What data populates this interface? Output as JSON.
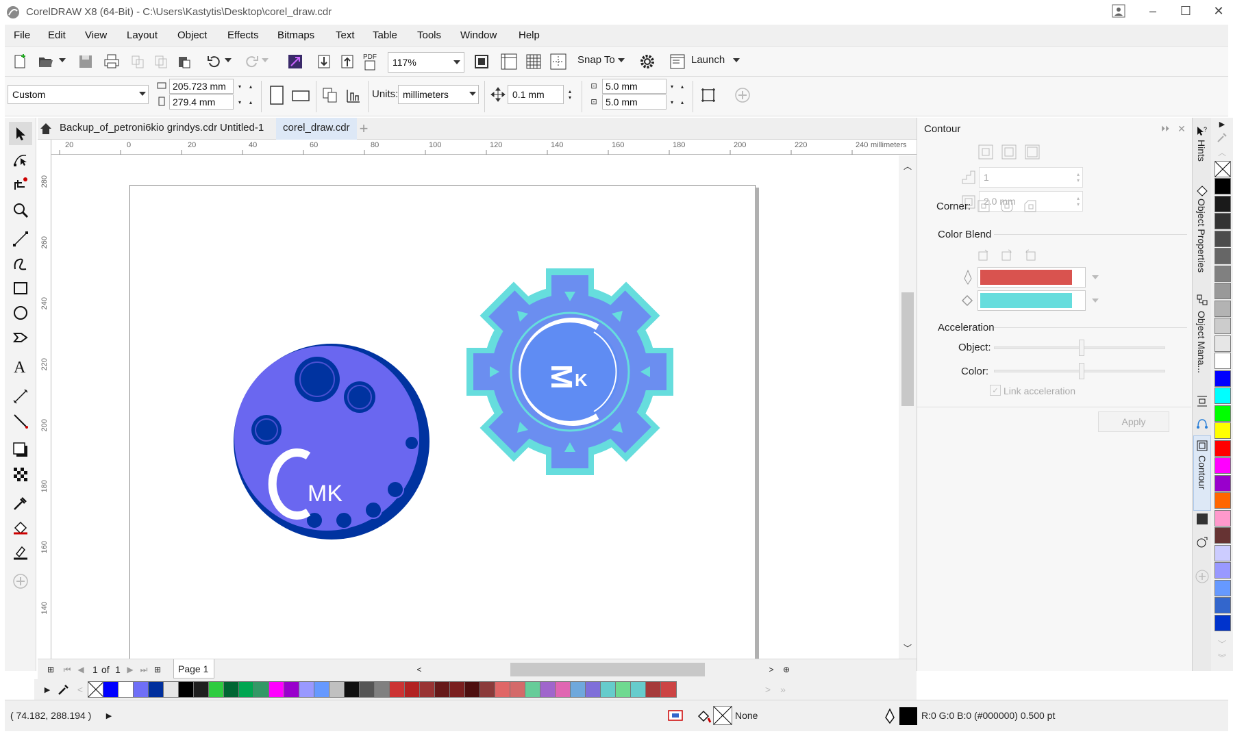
{
  "window": {
    "title": "CorelDRAW X8 (64-Bit) - C:\\Users\\Kastytis\\Desktop\\corel_draw.cdr"
  },
  "menu": [
    "File",
    "Edit",
    "View",
    "Layout",
    "Object",
    "Effects",
    "Bitmaps",
    "Text",
    "Table",
    "Tools",
    "Window",
    "Help"
  ],
  "toolbar1": {
    "zoom": "117%",
    "snap_to": "Snap To",
    "launch": "Launch"
  },
  "toolbar2": {
    "page_size": "Custom",
    "width": "205.723 mm",
    "height": "279.4 mm",
    "units_label": "Units:",
    "units": "millimeters",
    "nudge": "0.1 mm",
    "dup_x": "5.0 mm",
    "dup_y": "5.0 mm"
  },
  "tabs": [
    "Backup_of_petroni6kio grindys.cdr",
    "Untitled-1",
    "corel_draw.cdr"
  ],
  "ruler": {
    "h_ticks": [
      "20",
      "0",
      "20",
      "40",
      "60",
      "80",
      "100",
      "120",
      "140",
      "160",
      "180",
      "200",
      "220",
      "240"
    ],
    "h_unit": "millimeters",
    "v_ticks": [
      "280",
      "260",
      "240",
      "220",
      "200",
      "180",
      "160",
      "140"
    ]
  },
  "artwork": {
    "logo1_text": "MK",
    "logo2_text_big": "M",
    "logo2_text_small": "K"
  },
  "pagebar": {
    "counter": "1",
    "of": "of",
    "total": "1",
    "page_tab": "Page 1"
  },
  "palette": [
    "#0000ff",
    "#ffffff",
    "#6f6ff7",
    "#002f9d",
    "#e6e6e6",
    "#000000",
    "#1f1f1f",
    "#2ecc40",
    "#006633",
    "#00a651",
    "#339966",
    "#ff00ff",
    "#9900cc",
    "#9999ff",
    "#6699ff",
    "#c0c0c0",
    "#111111",
    "#555555",
    "#808080",
    "#cc3333",
    "#b22222",
    "#993333",
    "#661919",
    "#7a1f1f",
    "#4d0f0f",
    "#8b3a3a",
    "#e06666",
    "#d46a6a",
    "#66cc99",
    "#a066cc",
    "#e066b2",
    "#6fa8dc",
    "#7f6fd9",
    "#66cccc",
    "#6fd990",
    "#66cccc",
    "#a63a3a",
    "#cc4444"
  ],
  "status": {
    "coords": "( 74.182, 288.194 )",
    "fill": "None",
    "outline": "R:0 G:0 B:0 (#000000)  0.500 pt"
  },
  "docker": {
    "title": "Contour",
    "steps": "1",
    "offset": "2.0 mm",
    "corner_label": "Corner:",
    "color_blend_label": "Color Blend",
    "outline_color": "#d9534f",
    "fill_color": "#66dddd",
    "acceleration_label": "Acceleration",
    "object_label": "Object:",
    "color_label": "Color:",
    "link_label": "Link acceleration",
    "apply": "Apply"
  },
  "vtabs": {
    "hints": "Hints",
    "object_properties": "Object Properties",
    "object_manager": "Object Mana...",
    "contour": "Contour"
  },
  "vpalette": [
    "#000000",
    "#1a1a1a",
    "#333333",
    "#4d4d4d",
    "#666666",
    "#808080",
    "#999999",
    "#b3b3b3",
    "#cccccc",
    "#e6e6e6",
    "#ffffff",
    "#0000ff",
    "#00ffff",
    "#00ff00",
    "#ffff00",
    "#ff0000",
    "#ff00ff",
    "#9900cc",
    "#ff6600",
    "#ff99cc",
    "#663333",
    "#ccccff",
    "#9999ff",
    "#6699ff",
    "#3366cc",
    "#0033cc"
  ]
}
